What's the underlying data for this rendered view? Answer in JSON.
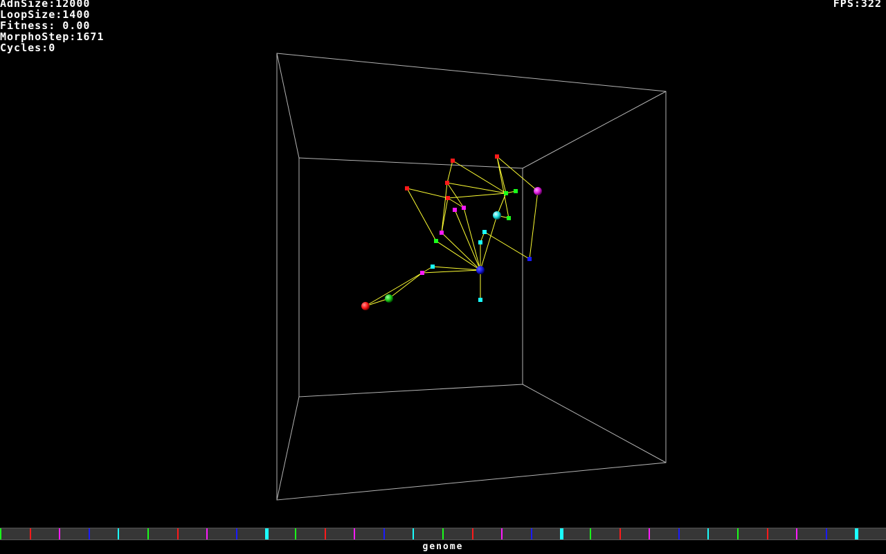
{
  "hud": {
    "stats": [
      {
        "label": "AdnSize",
        "value": "12000",
        "text": "AdnSize:12000"
      },
      {
        "label": "LoopSize",
        "value": "1400",
        "text": "LoopSize:1400"
      },
      {
        "label": "Fitness",
        "value": "0.00",
        "text": "Fitness: 0.00"
      },
      {
        "label": "MorphoStep",
        "value": "1671",
        "text": "MorphoStep:1671"
      },
      {
        "label": "Cycles",
        "value": "0",
        "text": "Cycles:0"
      }
    ],
    "fps_text": "FPS:322"
  },
  "colors": {
    "background": "#000000",
    "box_edge": "#b4b4b4",
    "link": "#ffff33",
    "red": "#ff1a1a",
    "green": "#1aff1a",
    "blue": "#1a1aff",
    "cyan": "#1affff",
    "magenta": "#ff1aff",
    "genome_bar": "#363636"
  },
  "creature": {
    "node_types": [
      "red",
      "green",
      "blue",
      "cyan",
      "magenta"
    ],
    "node_count": 24,
    "link_count": 32
  },
  "genome": {
    "label": "genome",
    "gene_sequence": [
      "green",
      "red",
      "magenta",
      "blue",
      "cyan",
      "green",
      "red",
      "magenta",
      "blue",
      "cyan",
      "green",
      "red",
      "magenta",
      "blue",
      "cyan",
      "green",
      "red",
      "magenta",
      "blue",
      "cyan",
      "green",
      "red",
      "magenta",
      "blue",
      "cyan",
      "green",
      "red",
      "magenta",
      "blue",
      "cyan"
    ]
  }
}
